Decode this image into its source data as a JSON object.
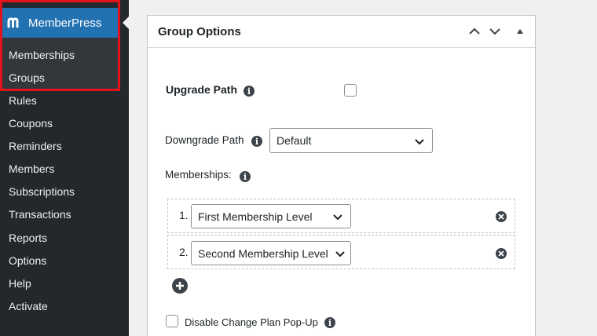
{
  "sidebar": {
    "brand": "MemberPress",
    "submenu": [
      {
        "label": "Memberships"
      },
      {
        "label": "Groups"
      }
    ],
    "items": [
      {
        "label": "Rules"
      },
      {
        "label": "Coupons"
      },
      {
        "label": "Reminders"
      },
      {
        "label": "Members"
      },
      {
        "label": "Subscriptions"
      },
      {
        "label": "Transactions"
      },
      {
        "label": "Reports"
      },
      {
        "label": "Options"
      },
      {
        "label": "Help"
      },
      {
        "label": "Activate"
      }
    ]
  },
  "panel": {
    "title": "Group Options",
    "upgrade_path": {
      "label": "Upgrade Path",
      "checked": false
    },
    "downgrade_path": {
      "label": "Downgrade Path",
      "selected": "Default"
    },
    "memberships": {
      "label": "Memberships:",
      "rows": [
        {
          "number": "1.",
          "selected": "First Membership Level"
        },
        {
          "number": "2.",
          "selected": "Second Membership Level"
        }
      ]
    },
    "disable_popup": {
      "label": "Disable Change Plan Pop-Up",
      "checked": false
    }
  },
  "colors": {
    "sidebar_bg": "#23282d",
    "accent": "#2271b1",
    "highlight_border": "#e3131b"
  }
}
